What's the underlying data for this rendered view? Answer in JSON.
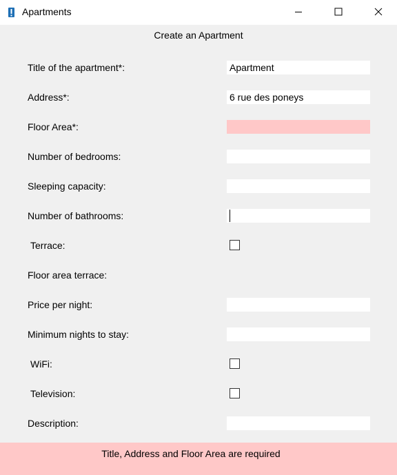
{
  "window": {
    "title": "Apartments",
    "app_icon": "exclamation-icon",
    "controls": [
      "minimize-icon",
      "maximize-icon",
      "close-icon"
    ]
  },
  "form": {
    "heading": "Create an Apartment",
    "fields": {
      "title": {
        "label": "Title of the apartment*:",
        "value": "Apartment"
      },
      "address": {
        "label": "Address*:",
        "value": "6 rue des poneys"
      },
      "floor_area": {
        "label": "Floor Area*:",
        "value": ""
      },
      "bedrooms": {
        "label": "Number of bedrooms:",
        "value": ""
      },
      "sleeping_capacity": {
        "label": "Sleeping capacity:",
        "value": ""
      },
      "bathrooms": {
        "label": "Number of bathrooms:",
        "value": ""
      },
      "terrace": {
        "label": "Terrace:",
        "checked": false
      },
      "terrace_area": {
        "label": "Floor area terrace:"
      },
      "price_per_night": {
        "label": "Price per night:",
        "value": ""
      },
      "min_nights": {
        "label": "Minimum nights to stay:",
        "value": ""
      },
      "wifi": {
        "label": "WiFi:",
        "checked": false
      },
      "television": {
        "label": "Television:",
        "checked": false
      },
      "description": {
        "label": "Description:",
        "value": ""
      }
    }
  },
  "error": {
    "message": "Title, Address and Floor Area are required"
  },
  "colors": {
    "window_background": "#f0f0f0",
    "titlebar_background": "#ffffff",
    "input_background": "#ffffff",
    "error_background": "#ffc8c8",
    "app_icon_color": "#1e6fb5"
  }
}
